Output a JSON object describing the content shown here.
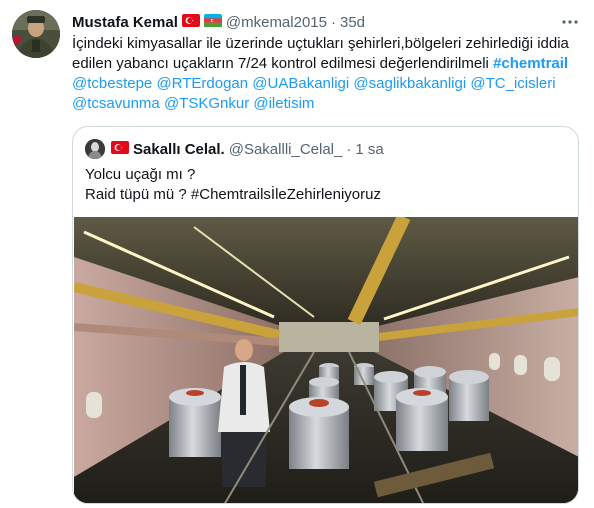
{
  "tweet": {
    "display_name": "Mustafa Kemal",
    "handle": "@mkemal2015",
    "separator": "·",
    "time": "35d",
    "text_line1": "İçindeki kimyasallar ile üzerinde uçtukları şehirleri,bölgeleri zehirlediği iddia",
    "text_line2_a": "edilen yabancı uçakların 7/24 kontrol edilmesi değerlendirilmeli ",
    "hashtag": "#chemtrail",
    "mentions_line1": [
      "@tcbestepe",
      "@RTErdogan",
      "@UABakanligi",
      "@saglikbakanligi",
      "@TC_icisleri"
    ],
    "mentions_line2": [
      "@tcsavunma",
      "@TSKGnkur",
      "@iletisim"
    ]
  },
  "quoted": {
    "display_name": "Sakallı Celal.",
    "handle": "@Sakallli_Celal_",
    "separator": "·",
    "time": "1 sa",
    "line1": "Yolcu uçağı mı ?",
    "line2_prefix": "Raid tüpü mü ? ",
    "line2_hashtag": "#ChemtrailsİleZehirleniyoruz"
  },
  "icons": {
    "flags": [
      "turkey-flag-icon",
      "azerbaijan-flag-icon",
      "turkey-flag-icon"
    ],
    "more": "more-icon"
  },
  "colors": {
    "link": "#1d9bf0",
    "text": "#0f1419",
    "muted": "#536471",
    "border": "#cfd9de"
  }
}
